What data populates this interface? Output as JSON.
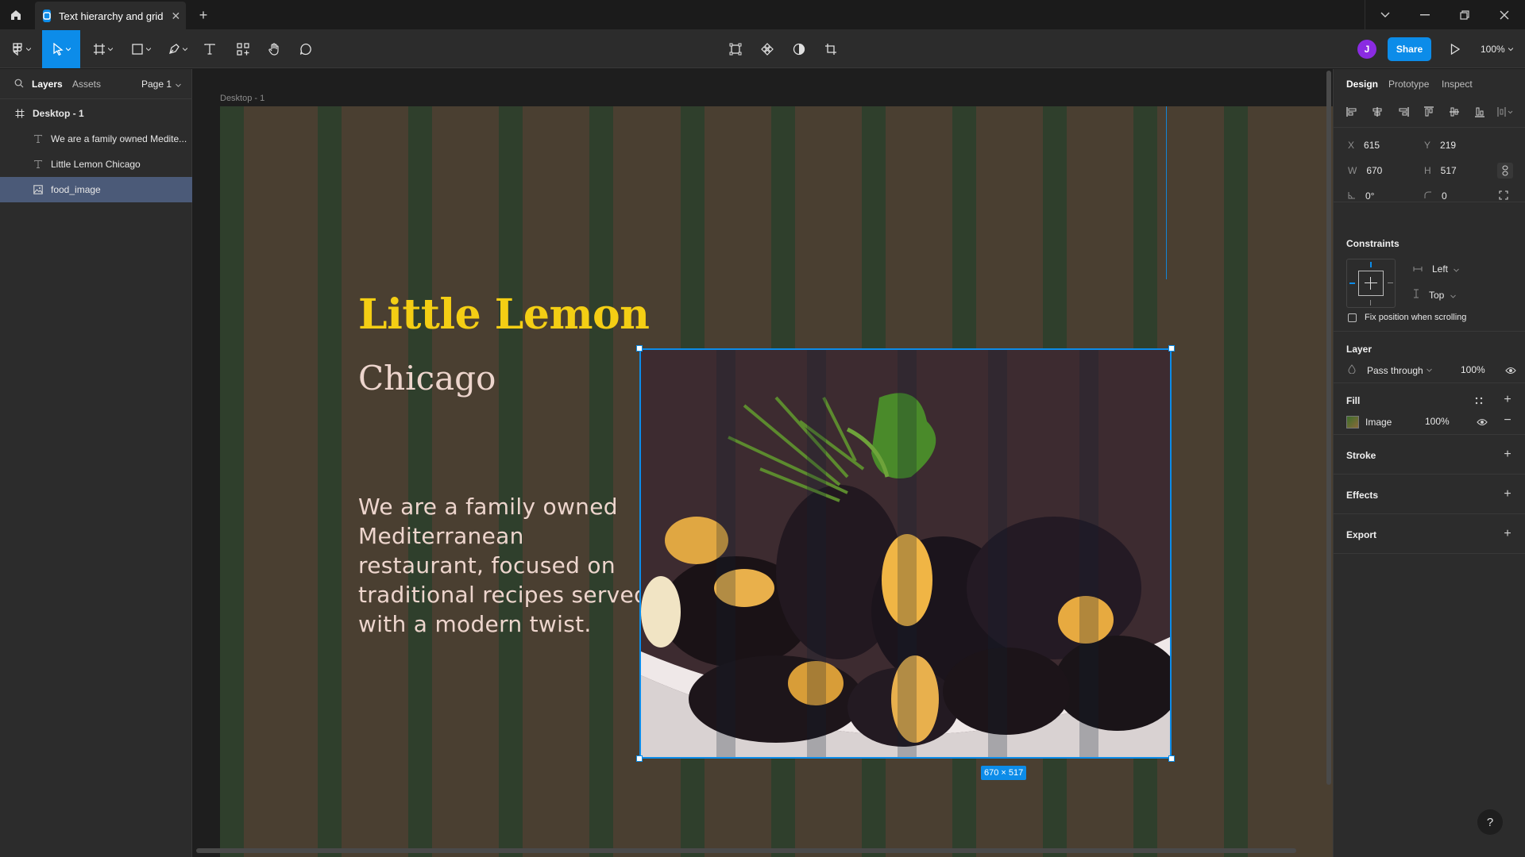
{
  "titlebar": {
    "tab_title": "Text hierarchy and grid",
    "new_tab": "+",
    "close_tab": "✕"
  },
  "toolbar": {
    "avatar_initial": "J",
    "share_label": "Share",
    "zoom": "100%"
  },
  "left_panel": {
    "tab_layers": "Layers",
    "tab_assets": "Assets",
    "page": "Page 1",
    "frame_name": "Desktop - 1",
    "layers": [
      {
        "name": "We are a family owned Medite...",
        "type": "text"
      },
      {
        "name": "Little Lemon Chicago",
        "type": "text"
      },
      {
        "name": "food_image",
        "type": "image",
        "selected": true
      }
    ]
  },
  "canvas": {
    "frame_label": "Desktop - 1",
    "heading": "Little Lemon",
    "subheading": "Chicago",
    "paragraph": "We are a family owned Mediterranean restaurant, focused on traditional recipes served with a modern twist.",
    "size_badge": "670 × 517",
    "colors": {
      "frame_bg": "#4a3f31",
      "grid_column": "#2f3f2c",
      "heading": "#f4ce14",
      "text": "#edd5cd",
      "selection": "#0c8ce9"
    }
  },
  "right_panel": {
    "tabs": [
      "Design",
      "Prototype",
      "Inspect"
    ],
    "x_label": "X",
    "x": "615",
    "y_label": "Y",
    "y": "219",
    "w_label": "W",
    "w": "670",
    "h_label": "H",
    "h": "517",
    "rotation": "0°",
    "radius": "0",
    "constraints_title": "Constraints",
    "constraint_h": "Left",
    "constraint_v": "Top",
    "fix_position": "Fix position when scrolling",
    "layer_title": "Layer",
    "blend_mode": "Pass through",
    "layer_opacity": "100%",
    "fill_title": "Fill",
    "fill_type": "Image",
    "fill_opacity": "100%",
    "stroke_title": "Stroke",
    "effects_title": "Effects",
    "export_title": "Export",
    "help": "?"
  }
}
